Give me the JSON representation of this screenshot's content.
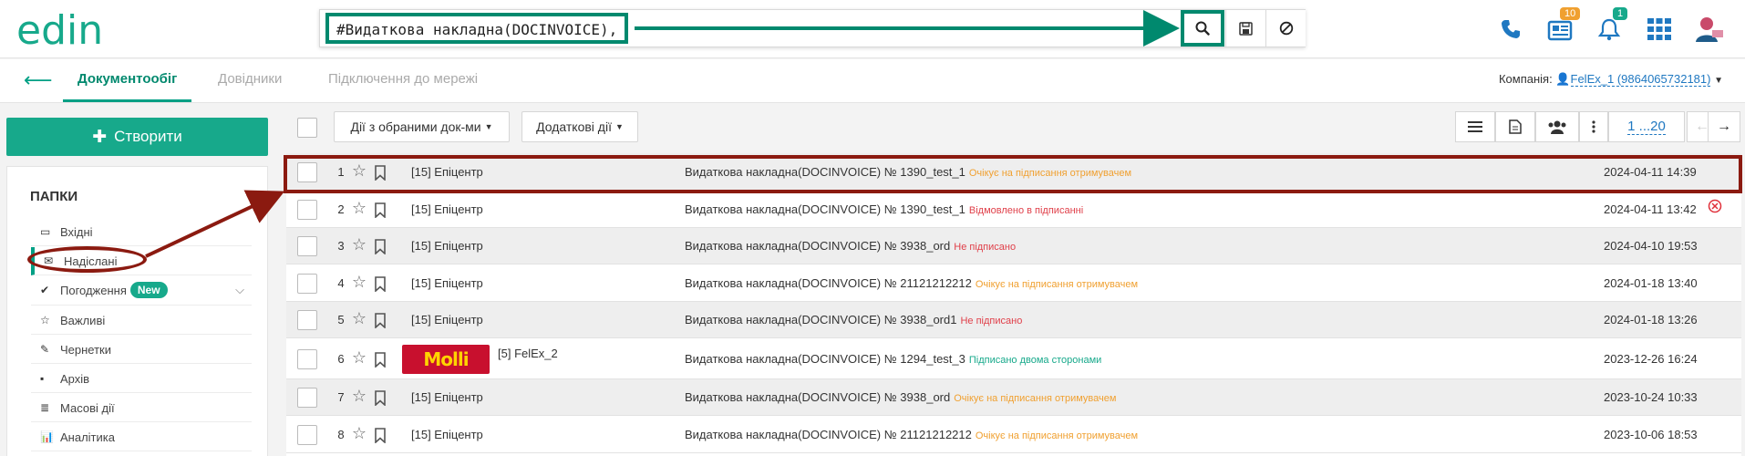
{
  "header": {
    "logo_text": "edin",
    "search_query": "#Видаткова накладна(DOCINVOICE),",
    "news_badge": "10",
    "notif_badge": "1"
  },
  "nav": {
    "tabs": [
      {
        "label": "Документообіг"
      },
      {
        "label": "Довідники"
      },
      {
        "label": "Підключення до мережі"
      }
    ],
    "company_label": "Компанія:",
    "company_value": "FelEx_1 (9864065732181)"
  },
  "sidebar": {
    "create_label": "Створити",
    "folders_title": "ПАПКИ",
    "folders": [
      {
        "label": "Вхідні",
        "icon": "inbox-icon"
      },
      {
        "label": "Надіслані",
        "icon": "envelope-icon"
      },
      {
        "label": "Погодження",
        "icon": "checkmark-icon",
        "badge": "New"
      },
      {
        "label": "Важливі",
        "icon": "star-icon"
      },
      {
        "label": "Чернетки",
        "icon": "draft-icon"
      },
      {
        "label": "Архів",
        "icon": "archive-icon"
      },
      {
        "label": "Масові дії",
        "icon": "bulk-icon"
      },
      {
        "label": "Аналітика",
        "icon": "chart-icon"
      }
    ]
  },
  "toolbar": {
    "selected_actions": "Дії з обраними док-ми",
    "extra_actions": "Додаткові дії",
    "pager": "1 ...20"
  },
  "documents": [
    {
      "num": "1",
      "sender": "[15] Епіцентр",
      "doc": "Видаткова накладна(DOCINVOICE) № 1390_test_1",
      "status": "Очікує на підписання отримувачем",
      "status_color": "#f0a030",
      "date": "2024-04-11 14:39"
    },
    {
      "num": "2",
      "sender": "[15] Епіцентр",
      "doc": "Видаткова накладна(DOCINVOICE) № 1390_test_1",
      "status": "Відмовлено в підписанні",
      "status_color": "#e0404a",
      "date": "2024-04-11 13:42"
    },
    {
      "num": "3",
      "sender": "[15] Епіцентр",
      "doc": "Видаткова накладна(DOCINVOICE) № 3938_ord",
      "status": "Не підписано",
      "status_color": "#e0404a",
      "date": "2024-04-10 19:53"
    },
    {
      "num": "4",
      "sender": "[15] Епіцентр",
      "doc": "Видаткова накладна(DOCINVOICE) № 21121212212",
      "status": "Очікує на підписання отримувачем",
      "status_color": "#f0a030",
      "date": "2024-01-18 13:40"
    },
    {
      "num": "5",
      "sender": "[15] Епіцентр",
      "doc": "Видаткова накладна(DOCINVOICE) № 3938_ord1",
      "status": "Не підписано",
      "status_color": "#e0404a",
      "date": "2024-01-18 13:26"
    },
    {
      "num": "6",
      "sender": "[5] FelEx_2",
      "logo": "Molli",
      "doc": "Видаткова накладна(DOCINVOICE) № 1294_test_3",
      "status": "Підписано двома сторонами",
      "status_color": "#17a98b",
      "date": "2023-12-26 16:24"
    },
    {
      "num": "7",
      "sender": "[15] Епіцентр",
      "doc": "Видаткова накладна(DOCINVOICE) № 3938_ord",
      "status": "Очікує на підписання отримувачем",
      "status_color": "#f0a030",
      "date": "2023-10-24 10:33"
    },
    {
      "num": "8",
      "sender": "[15] Епіцентр",
      "doc": "Видаткова накладна(DOCINVOICE) № 21121212212",
      "status": "Очікує на підписання отримувачем",
      "status_color": "#f0a030",
      "date": "2023-10-06 18:53"
    }
  ]
}
